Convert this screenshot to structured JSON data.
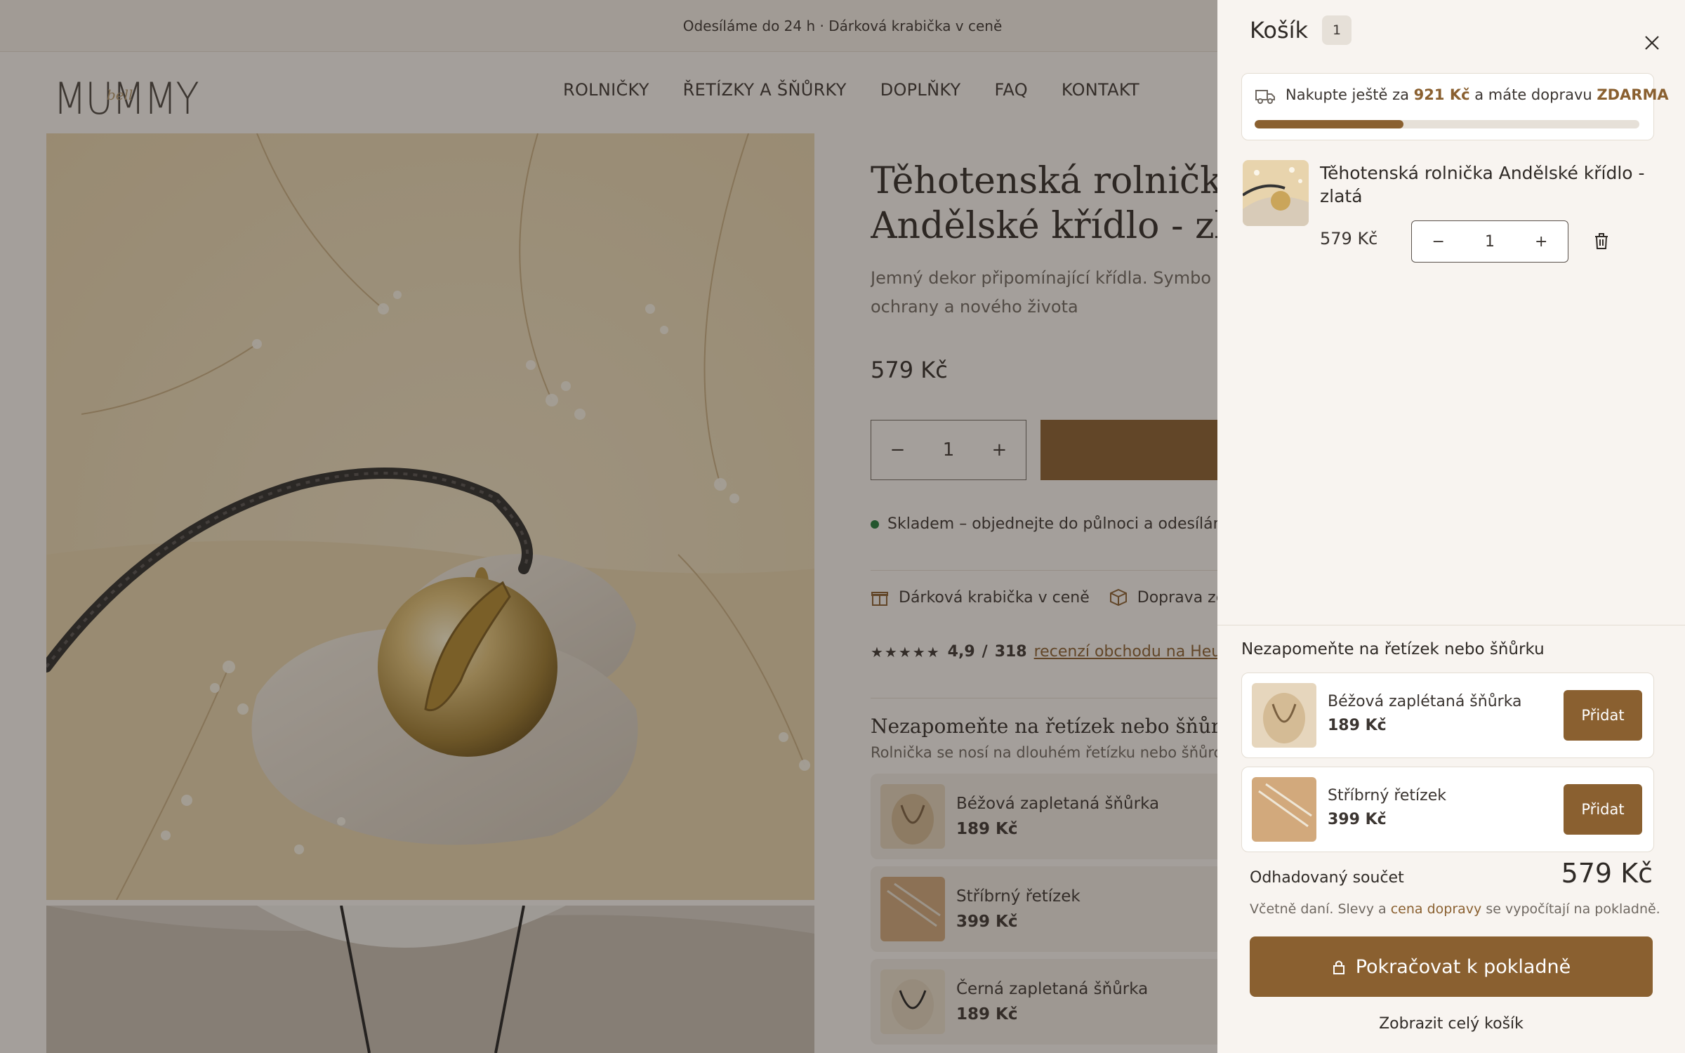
{
  "announcement": "Odesíláme do 24 h · Dárková krabička v ceně",
  "brand": {
    "logo": "MUMMY",
    "accent": "#8a6030",
    "text": "#3b3531"
  },
  "nav": [
    "ROLNIČKY",
    "ŘETÍZKY A ŠŇŮRKY",
    "DOPLŇKY",
    "FAQ",
    "KONTAKT"
  ],
  "product": {
    "title_line1": "Těhotenská rolnička",
    "title_line2": "Andělské křídlo - zla",
    "subtitle_line1": "Jemný dekor připomínající křídla. Symbo",
    "subtitle_line2": "ochrany a nového života",
    "price": "579 Kč",
    "quantity": "1",
    "stock": "Skladem – objednejte do půlnoci a odesílám",
    "features": [
      "Dárková krabička v ceně",
      "Doprava ze"
    ],
    "rating": {
      "value": "4,9",
      "sep": "/",
      "count": "318",
      "link": "recenzí obchodu na Heu"
    }
  },
  "extras": {
    "title": "Nezapomeňte na řetízek nebo šňůrku",
    "subtitle": "Rolnička se nosí na dlouhém řetízku nebo šňůrce.",
    "items": [
      {
        "name": "Béžová zapletaná šňůrka",
        "price": "189 Kč"
      },
      {
        "name": "Stříbrný řetízek",
        "price": "399 Kč"
      },
      {
        "name": "Černá zapletaná šňůrka",
        "price": "189 Kč"
      }
    ]
  },
  "cart": {
    "title": "Košík",
    "count": "1",
    "shipping": {
      "prefix": "Nakupte ještě za",
      "amount": "921 Kč",
      "middle": "a máte dopravu",
      "free": "ZDARMA",
      "progress": 0.386
    },
    "item": {
      "name": "Těhotenská rolnička Andělské křídlo - zlatá",
      "price": "579 Kč",
      "quantity": "1"
    },
    "upsell_title": "Nezapomeňte na řetízek nebo šňůrku",
    "upsell": [
      {
        "name": "Béžová zaplétaná šňůrka",
        "price": "189 Kč",
        "button": "Přidat"
      },
      {
        "name": "Stříbrný řetízek",
        "price": "399 Kč",
        "button": "Přidat"
      }
    ],
    "subtotal_label": "Odhadovaný součet",
    "subtotal": "579 Kč",
    "tax_prefix": "Včetně daní. Slevy a",
    "tax_link": "cena dopravy",
    "tax_suffix": "se vypočítají na pokladně.",
    "checkout": "Pokračovat k pokladně",
    "view_cart": "Zobrazit celý košík"
  }
}
